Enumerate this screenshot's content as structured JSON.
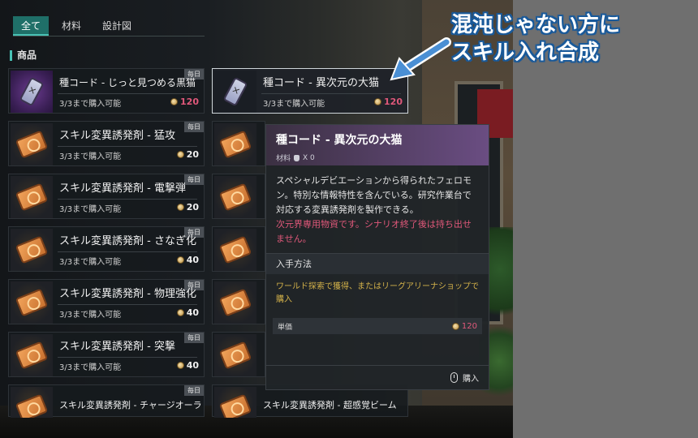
{
  "tabs": [
    {
      "label": "全て",
      "active": true
    },
    {
      "label": "材料",
      "active": false
    },
    {
      "label": "設計図",
      "active": false
    }
  ],
  "section_title": "商品",
  "items": [
    {
      "name": "種コード - じっと見つめる黒猫",
      "limit": "3/3まで購入可能",
      "price": "120",
      "daily": "毎日",
      "icon": "vial-icon",
      "price_color": "#e0587a"
    },
    {
      "name": "種コード - 異次元の大猫",
      "limit": "3/3まで購入可能",
      "price": "120",
      "daily": "毎日",
      "icon": "vial-icon",
      "price_color": "#e0587a",
      "selected": true
    },
    {
      "name": "スキル変異誘発剤 - 猛攻",
      "limit": "3/3まで購入可能",
      "price": "20",
      "daily": "毎日",
      "icon": "ticket-icon"
    },
    {
      "name": "スキル変異誘発剤 - 電撃弾",
      "limit": "3/3まで購入可能",
      "price": "20",
      "daily": "毎日",
      "icon": "ticket-icon"
    },
    {
      "name": "スキル変異誘発剤 - さなぎ化",
      "limit": "3/3まで購入可能",
      "price": "40",
      "daily": "毎日",
      "icon": "ticket-icon"
    },
    {
      "name": "スキル変異誘発剤 - 物理強化",
      "limit": "3/3まで購入可能",
      "price": "40",
      "daily": "毎日",
      "icon": "ticket-icon"
    },
    {
      "name": "スキル変異誘発剤 - 突撃",
      "limit": "3/3まで購入可能",
      "price": "40",
      "daily": "毎日",
      "icon": "ticket-icon"
    },
    {
      "name": "スキル変異誘発剤 - チャージオーラ",
      "daily": "毎日",
      "icon": "ticket-icon"
    },
    {
      "name": "スキル変異誘発剤 - 超感覚ビーム",
      "daily": "毎日",
      "icon": "ticket-icon"
    }
  ],
  "tooltip": {
    "title": "種コード - 異次元の大猫",
    "category": "材料",
    "owned": "X 0",
    "description": "スペシャルデビエーションから得られたフェロモン。特別な情報特性を含んでいる。研究作業台で対応する変異誘発剤を製作できる。",
    "warning": "次元界専用物資です。シナリオ終了後は持ち出せません。",
    "acquire_header": "入手方法",
    "acquire_text": "ワールド探索で獲得、またはリーグアリーナショップで購入",
    "unit_price_label": "単価",
    "unit_price": "120",
    "buy_label": "購入"
  },
  "annotation": {
    "line1": "混沌じゃない方に",
    "line2": "スキル入れ合成",
    "color": "#1a5a9a"
  },
  "colors": {
    "accent": "#48c1b4",
    "price_red": "#e0587a",
    "acquire_text": "#d4b24a"
  }
}
